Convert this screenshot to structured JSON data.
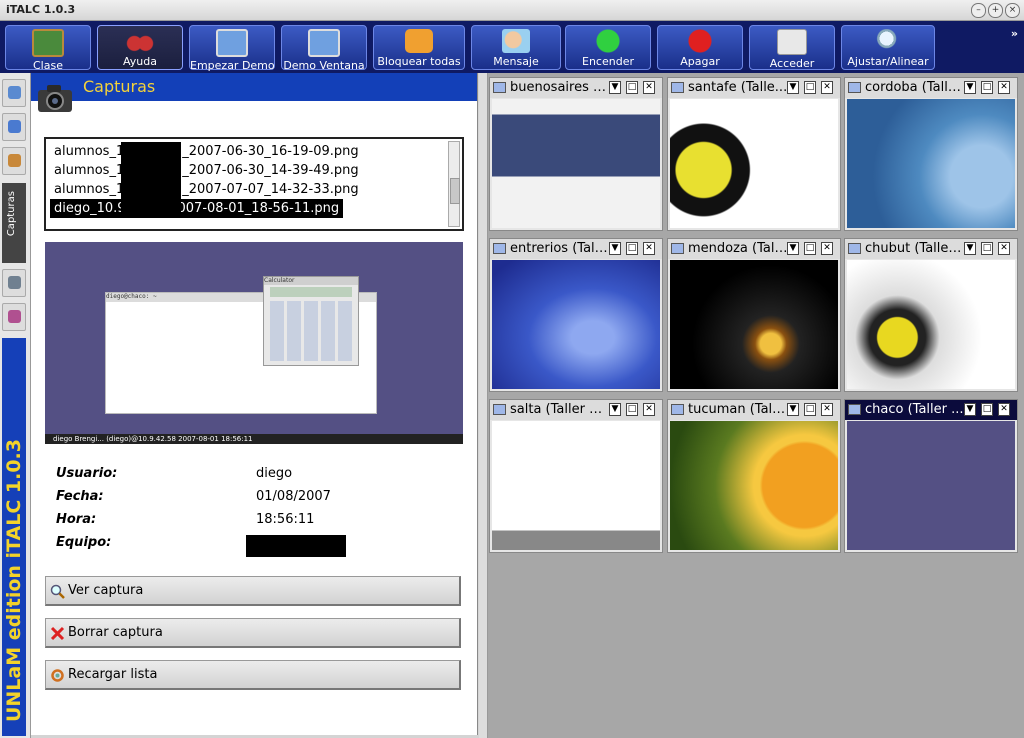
{
  "window": {
    "title": "iTALC 1.0.3"
  },
  "toolbar": {
    "buttons": [
      {
        "label": "Clase",
        "icon": "chalkboard-icon"
      },
      {
        "label": "Ayuda",
        "icon": "binoculars-icon"
      },
      {
        "label": "Empezar Demo",
        "icon": "demo-screens-icon"
      },
      {
        "label": "Demo Ventana",
        "icon": "demo-window-icon"
      },
      {
        "label": "Bloquear todas",
        "icon": "lock-icon"
      },
      {
        "label": "Mensaje",
        "icon": "message-icon"
      },
      {
        "label": "Encender",
        "icon": "power-on-icon"
      },
      {
        "label": "Apagar",
        "icon": "power-off-icon"
      },
      {
        "label": "Acceder",
        "icon": "login-icon"
      },
      {
        "label": "Ajustar/Alinear",
        "icon": "magnifier-icon"
      }
    ],
    "more": "»",
    "accent": "#0f1a63"
  },
  "sidebar": {
    "tab_label": "Capturas",
    "brand": "UNLaM edition iTALC 1.0.3",
    "brand_color": "#f3d32a"
  },
  "panel": {
    "title": "Capturas",
    "files": [
      {
        "prefix": "alumnos_1",
        "suffix": "_2007-06-30_16-19-09.png"
      },
      {
        "prefix": "alumnos_1",
        "suffix": "_2007-06-30_14-39-49.png"
      },
      {
        "prefix": "alumnos_1",
        "suffix": "_2007-07-07_14-32-33.png"
      },
      {
        "prefix": "diego_10.9",
        "suffix": "007-08-01_18-56-11.png",
        "selected": true
      }
    ],
    "preview": {
      "term_title": "diego@chaco: ~",
      "calc_title": "Calculator",
      "status": "diego Brengi... (diego)@10.9.42.58 2007-08-01 18:56:11"
    },
    "info": [
      {
        "label": "Usuario:",
        "value": "diego"
      },
      {
        "label": "Fecha:",
        "value": "01/08/2007"
      },
      {
        "label": "Hora:",
        "value": "18:56:11"
      },
      {
        "label": "Equipo:",
        "value": ""
      }
    ],
    "actions": [
      {
        "label": "Ver captura",
        "icon": "magnifier-icon"
      },
      {
        "label": "Borrar captura",
        "icon": "delete-icon"
      },
      {
        "label": "Recargar lista",
        "icon": "reload-icon"
      }
    ]
  },
  "clients": [
    {
      "name": "buenosaires (...",
      "screen": "buenosaires"
    },
    {
      "name": "santafe  (Talle...",
      "screen": "santafe"
    },
    {
      "name": "cordoba (Talle...",
      "screen": "cordoba"
    },
    {
      "name": "entrerios (Tall...",
      "screen": "entrerios"
    },
    {
      "name": "mendoza (Tall...",
      "screen": "mendoza"
    },
    {
      "name": "chubut (Taller ...",
      "screen": "chubut"
    },
    {
      "name": "salta (Taller G...",
      "screen": "salta"
    },
    {
      "name": "tucuman (Tall...",
      "screen": "tucuman"
    },
    {
      "name": "chaco (Taller ...",
      "screen": "chaco",
      "active": true
    }
  ],
  "tile_buttons": {
    "minimize": "▼",
    "maximize": "□",
    "close": "✕"
  }
}
